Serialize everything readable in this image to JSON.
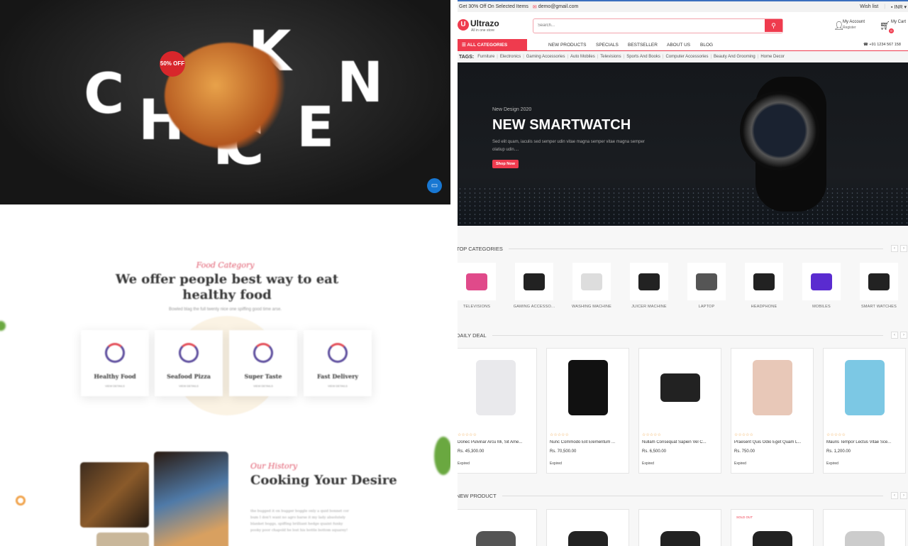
{
  "left_site": {
    "hero": {
      "letters": [
        "C",
        "H",
        "I",
        "C",
        "K",
        "E",
        "N"
      ],
      "badge": "50% OFF"
    },
    "food_category": {
      "kicker": "Food Category",
      "title": "We offer people best way to eat healthy food",
      "desc": "Bowled blag the full twenty nice one spiffing good time arse.",
      "cards": [
        {
          "title": "Healthy Food",
          "link": "VIEW DETAILS"
        },
        {
          "title": "Seafood Pizza",
          "link": "VIEW DETAILS"
        },
        {
          "title": "Super Taste",
          "link": "VIEW DETAILS"
        },
        {
          "title": "Fast Delivery",
          "link": "VIEW DETAILS"
        }
      ]
    },
    "history": {
      "kicker": "Our History",
      "title": "Cooking Your Desire",
      "desc": "the bugged it on bugger boggle only a quid bonnet cor bum I don't want no agro barse it my lady absolutely blanket boggs, spiffing brilliant hedge quaint funky pooky poor chapold he lost his bottle bottom squarey!"
    }
  },
  "shop": {
    "topbar": {
      "promo": "Get 30% Off On Selected Items",
      "email": "demo@gmail.com",
      "wishlist": "Wish list",
      "currency": "INR"
    },
    "logo": {
      "name": "Ultrazo",
      "tagline": "All in one store"
    },
    "search": {
      "placeholder": "Search..."
    },
    "account": {
      "label": "My Account",
      "sub": "Register"
    },
    "cart": {
      "label": "My Cart",
      "count": "0"
    },
    "nav": {
      "all_categories": "ALL CATEGORIES",
      "links": [
        "NEW PRODUCTS",
        "SPECIALS",
        "BESTSELLER",
        "ABOUT US",
        "BLOG"
      ],
      "phone": "+91 1234 567 158"
    },
    "tags": {
      "label": "TAGS:",
      "items": [
        "Furniture",
        "Electronics",
        "Gaming Accessories",
        "Auto Mobiles",
        "Televisions",
        "Sports And Books",
        "Computer Accessories",
        "Beauty And Grooming",
        "Home Decor"
      ]
    },
    "banner": {
      "kicker": "New Design 2020",
      "title": "NEW SMARTWATCH",
      "desc": "Sed elit quam, iaculis sed semper udin vitae magna semper  vitae magna semper olatiup udin....",
      "button": "Shop Now"
    },
    "top_categories": {
      "title": "TOP CATEGORIES",
      "items": [
        "TELEVISIONS",
        "GAMING ACCESSO...",
        "WASHING MACHINE",
        "JUICER MACHINE",
        "LAPTOP",
        "HEADPHONE",
        "MOBILES",
        "SMART WATCHES"
      ]
    },
    "daily_deal": {
      "title": "DAILY DEAL",
      "items": [
        {
          "name": "Donec Pulvinar Arcu Mi, Sit Ame...",
          "price": "Rs. 45,300.00",
          "status": "Expired",
          "stars": "☆☆☆☆☆"
        },
        {
          "name": "Nunc Commodo Elit Elementum ...",
          "price": "Rs. 70,500.00",
          "status": "Expired",
          "stars": "☆☆☆☆☆"
        },
        {
          "name": "Nullam Consequat Sapien Vel C...",
          "price": "Rs. 6,500.00",
          "status": "Expired",
          "stars": "☆☆☆☆☆"
        },
        {
          "name": "Praesent Quis Odio Eget Quam L...",
          "price": "Rs. 750.00",
          "status": "Expired",
          "stars": "☆☆☆☆☆"
        },
        {
          "name": "Mauris Tempor Lectus Vitae Sce...",
          "price": "Rs. 1,200.00",
          "status": "Expired",
          "stars": "☆☆☆☆☆"
        }
      ]
    },
    "new_product": {
      "title": "NEW PRODUCT",
      "sold_out": "SOLD OUT"
    },
    "colors": {
      "accent": "#ef3b4e",
      "topline": "#3b6fbf"
    }
  }
}
